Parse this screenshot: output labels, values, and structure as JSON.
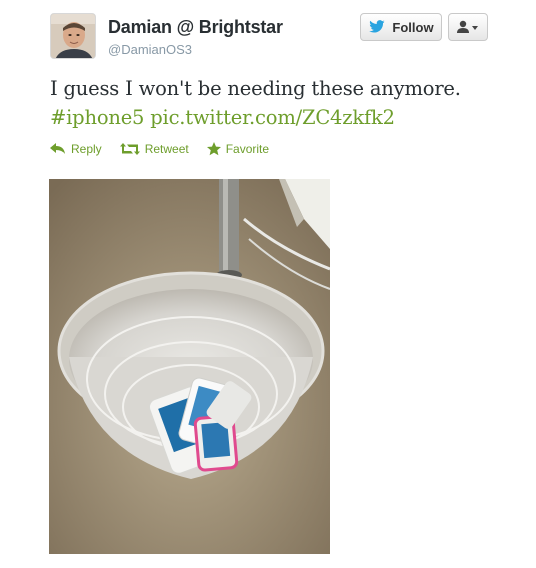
{
  "user": {
    "name": "Damian @ Brightstar",
    "handle": "@DamianOS3"
  },
  "buttons": {
    "follow_label": "Follow",
    "follow_icon": "twitter-bird-icon",
    "user_menu_icon": "user-dropdown-icon"
  },
  "tweet": {
    "text": "I guess I won't be needing these anymore.",
    "hashtag": "#iphone5",
    "link": "pic.twitter.com/ZC4zkfk2"
  },
  "actions": [
    {
      "label": "Reply",
      "icon": "reply-arrow-icon"
    },
    {
      "label": "Retweet",
      "icon": "retweet-icon"
    },
    {
      "label": "Favorite",
      "icon": "star-icon"
    }
  ],
  "colors": {
    "link": "#6e9e2c",
    "twitter_blue": "#2aa4e0"
  }
}
